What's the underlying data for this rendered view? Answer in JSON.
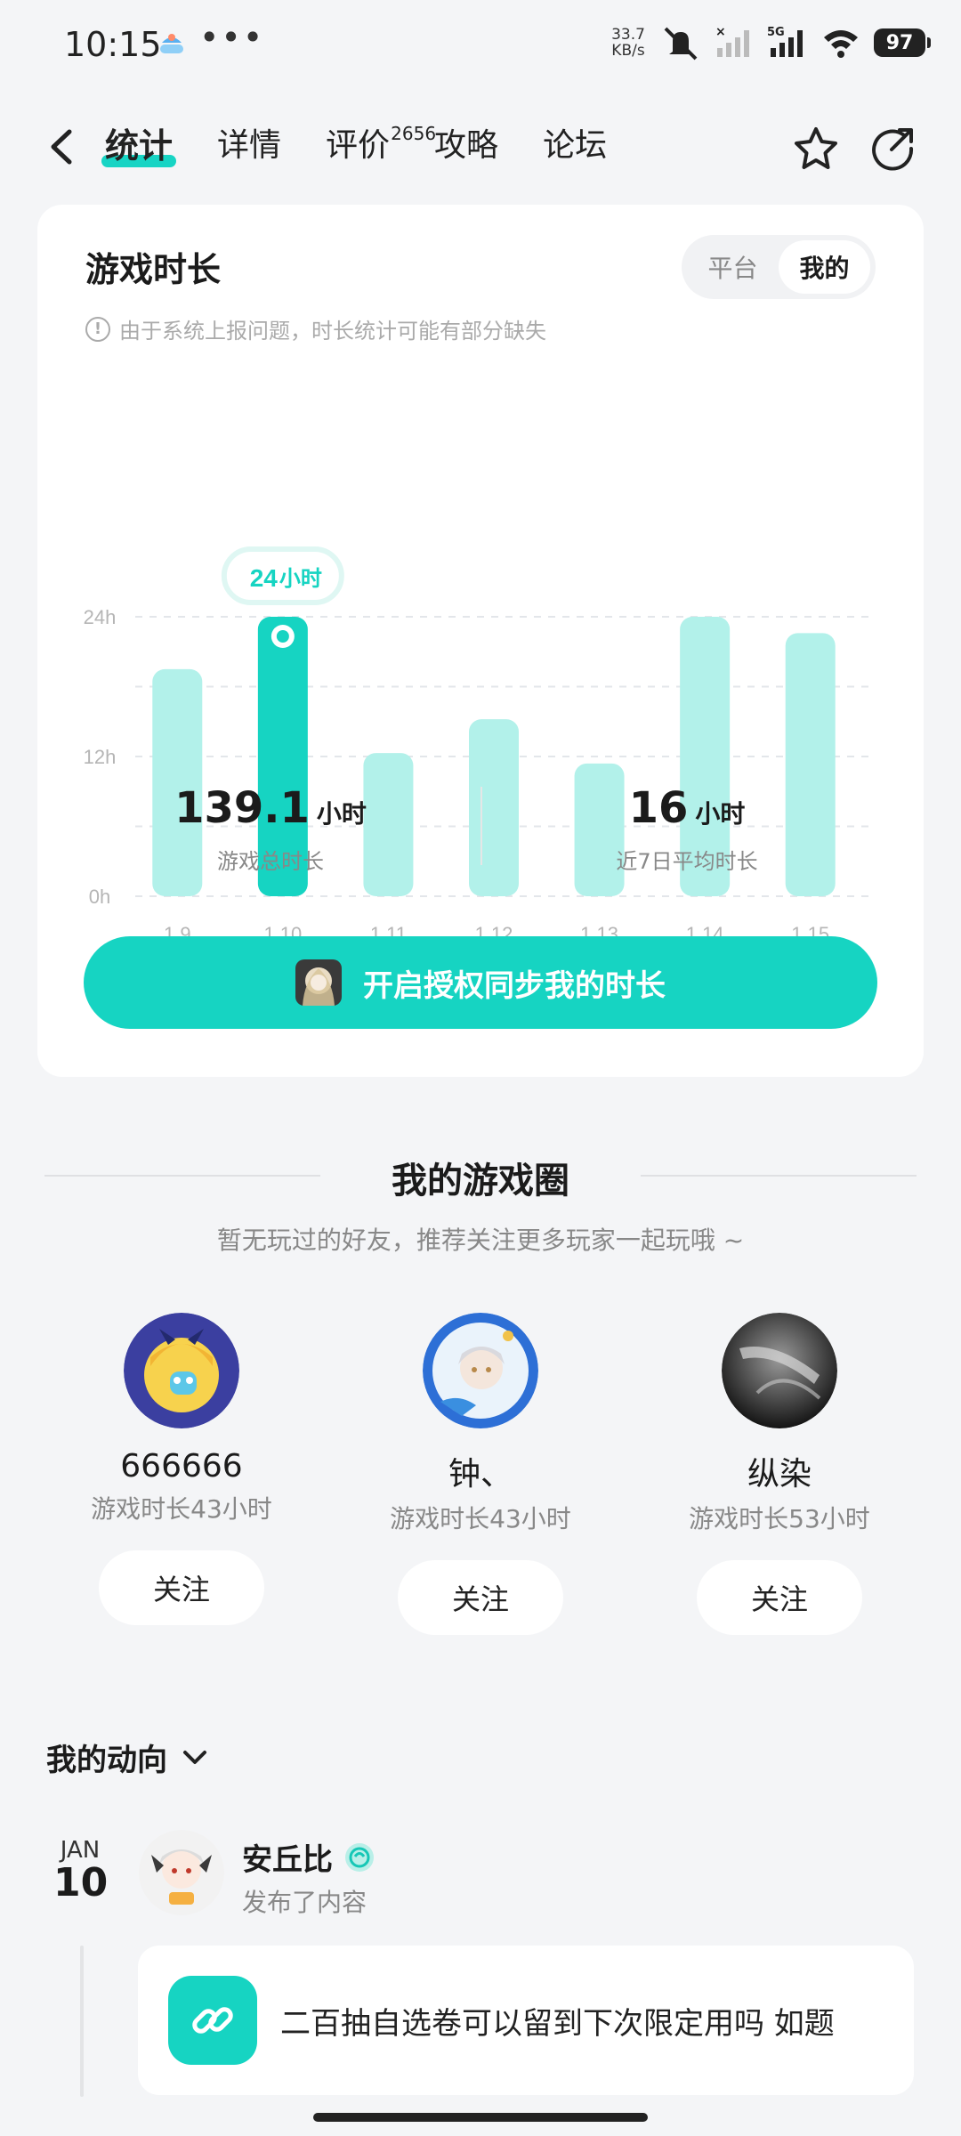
{
  "status_bar": {
    "time": "10:15",
    "dots": "•••",
    "net_speed_value": "33.7",
    "net_speed_unit": "KB/s",
    "network_type": "5G",
    "battery": "97"
  },
  "nav": {
    "tabs": [
      {
        "label": "统计",
        "active": true
      },
      {
        "label": "详情"
      },
      {
        "label": "评价",
        "badge": "2656"
      },
      {
        "label": "攻略"
      },
      {
        "label": "论坛"
      }
    ]
  },
  "stats": {
    "title": "游戏时长",
    "segment": {
      "options": [
        "平台",
        "我的"
      ],
      "selected": "我的"
    },
    "notice": "由于系统上报问题，时长统计可能有部分缺失",
    "tooltip": {
      "value": "24",
      "unit": "小时"
    },
    "total": {
      "value": "139.1",
      "unit": "小时",
      "label": "游戏总时长"
    },
    "average": {
      "value": "16",
      "unit": "小时",
      "label": "近7日平均时长"
    },
    "sync_button": "开启授权同步我的时长",
    "colors": {
      "accent": "#16d4c2",
      "bar_light": "#b2f1ea"
    }
  },
  "chart_data": {
    "type": "bar",
    "categories": [
      "1.9",
      "1.10",
      "1.11",
      "1.12",
      "1.13",
      "1.14",
      "1.15"
    ],
    "values": [
      19.5,
      24,
      12.3,
      15.2,
      11.4,
      24,
      22.6
    ],
    "highlight_index": 1,
    "y_ticks": [
      "0h",
      "12h",
      "24h"
    ],
    "ylim": [
      0,
      24
    ],
    "grid": true
  },
  "circle": {
    "title": "我的游戏圈",
    "subtitle": "暂无玩过的好友，推荐关注更多玩家一起玩哦 ~",
    "friends": [
      {
        "name": "666666",
        "time": "游戏时长43小时",
        "follow": "关注"
      },
      {
        "name": "钟、",
        "time": "游戏时长43小时",
        "follow": "关注"
      },
      {
        "name": "纵染",
        "time": "游戏时长53小时",
        "follow": "关注"
      }
    ]
  },
  "activity": {
    "header": "我的动向",
    "date_month": "JAN",
    "date_day": "10",
    "user": "安丘比",
    "action": "发布了内容",
    "post_text": "二百抽自选卷可以留到下次限定用吗 如题"
  }
}
